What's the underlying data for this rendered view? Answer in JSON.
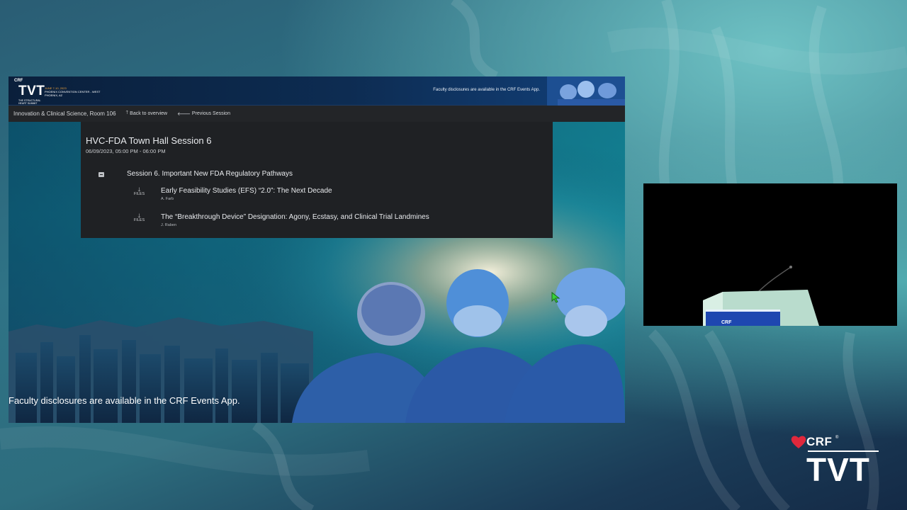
{
  "banner": {
    "brand_small": "CRF",
    "brand_big": "TVT",
    "summit_line": "THE STRUCTURAL HEART SUMMIT",
    "dates": "JUNE 7-10, 2023",
    "venue": "PHOENIX CONVENTION CENTER - WEST",
    "city": "PHOENIX, AZ",
    "disclosure": "Faculty disclosures are available in the CRF Events App."
  },
  "navbar": {
    "room": "Innovation & Clinical Science, Room 106",
    "back_label": "Back to overview",
    "prev_label": "Previous Session",
    "back_icon": "arrow-up-icon",
    "prev_icon": "arrow-left-icon"
  },
  "session": {
    "title": "HVC-FDA Town Hall Session 6",
    "time": "06/09/2023, 05:00 PM - 06:00 PM",
    "group_label": "Session 6. Important New FDA Regulatory Pathways",
    "talks": [
      {
        "files_label": "FILES",
        "title": "Early Feasibility Studies (EFS) “2.0”: The Next Decade",
        "author": "A. Farb"
      },
      {
        "files_label": "FILES",
        "title": "The “Breakthrough Device” Designation: Agony, Ecstasy, and Clinical Trial Landmines",
        "author": "J. Raben"
      }
    ]
  },
  "slide_footer": "Faculty disclosures are available in the CRF Events App.",
  "video": {
    "podium_text": "CRF"
  },
  "corner_logo": {
    "crf": "CRF",
    "reg": "®",
    "tvt": "TVT"
  },
  "colors": {
    "accent_red": "#e0283c",
    "panel_bg": "#1f2124",
    "navbar_bg": "#232528"
  }
}
